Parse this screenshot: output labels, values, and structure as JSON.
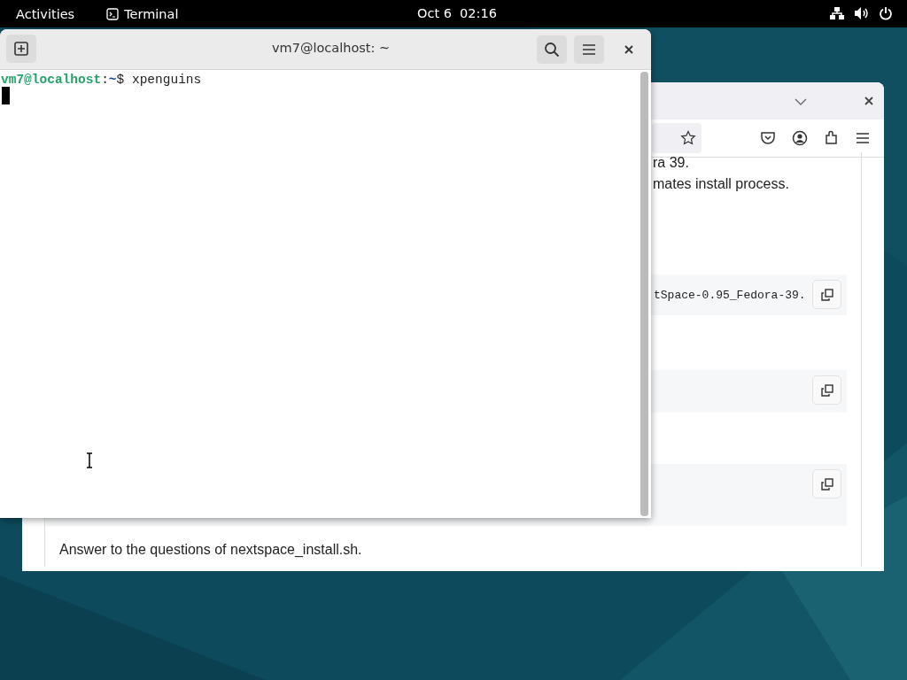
{
  "top_bar": {
    "activities": "Activities",
    "app": "Terminal",
    "date": "Oct 6",
    "time": "02:16"
  },
  "browser": {
    "visible_lines": [
      {
        "kind": "text",
        "text": "ra 39."
      },
      {
        "kind": "text",
        "text": "mates install process."
      },
      {
        "kind": "code",
        "text": "tSpace-0.95_Fedora-39."
      },
      {
        "kind": "code"
      },
      {
        "kind": "code"
      }
    ],
    "footer_text": "Answer to the questions of nextspace_install.sh."
  },
  "terminal": {
    "title": "vm7@localhost: ~",
    "prompt_user": "vm7@localhost",
    "prompt_sep": ":",
    "prompt_path": "~",
    "prompt_end": "$",
    "command": "xpenguins"
  }
}
